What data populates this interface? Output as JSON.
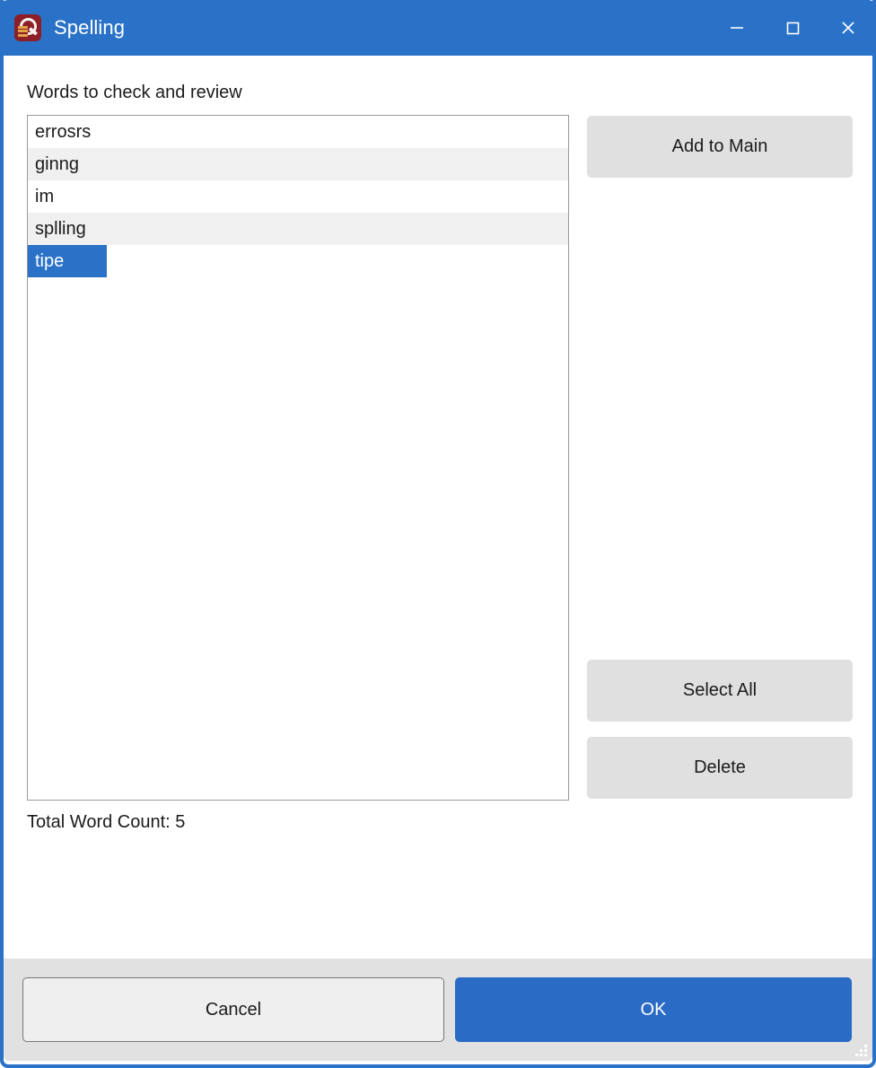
{
  "window": {
    "title": "Spelling",
    "app_icon": "spelling-dictionary-icon",
    "accent_color": "#2a72c8",
    "controls": {
      "minimize": "minimize-icon",
      "maximize": "maximize-icon",
      "close": "close-icon"
    }
  },
  "main": {
    "list_label": "Words to check and review",
    "words": [
      {
        "text": "errosrs",
        "selected": false
      },
      {
        "text": "ginng",
        "selected": false
      },
      {
        "text": "im",
        "selected": false
      },
      {
        "text": "splling",
        "selected": false
      },
      {
        "text": "tipe",
        "selected": true
      }
    ],
    "count_label": "Total Word Count: 5",
    "selection_color": "#2a72c8",
    "alt_row_color": "#f0f0f0"
  },
  "side_buttons": {
    "add_to_main": "Add to Main",
    "select_all": "Select All",
    "delete": "Delete"
  },
  "footer": {
    "cancel": "Cancel",
    "ok": "OK",
    "ok_color": "#2a6bc6",
    "resize_grip": "resize-grip-icon"
  }
}
